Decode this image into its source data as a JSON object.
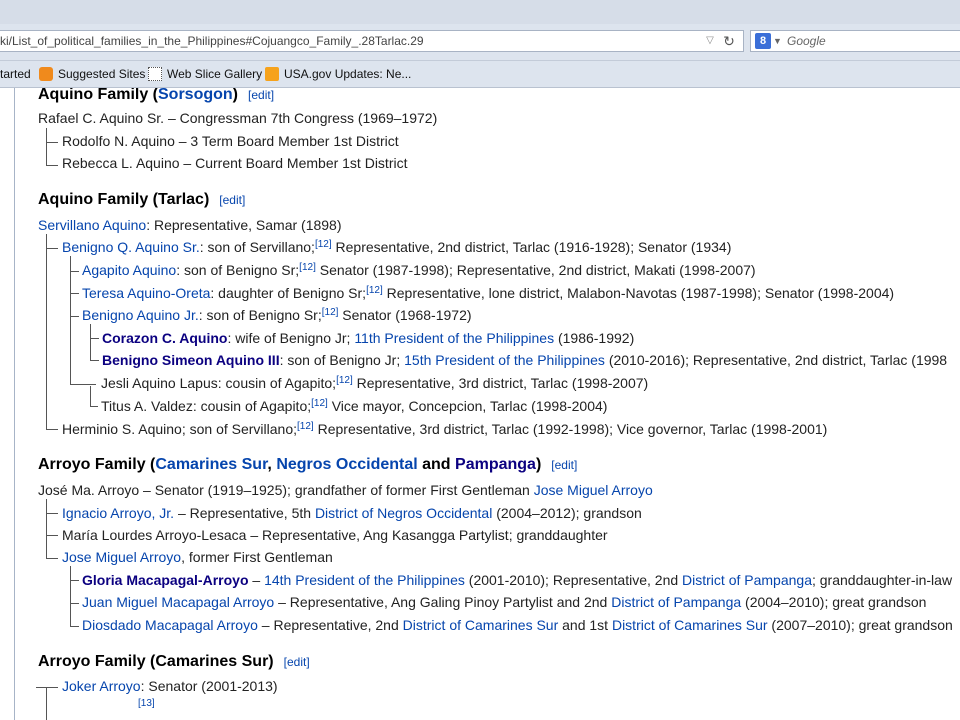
{
  "browser": {
    "url": "ki/List_of_political_families_in_the_Philippines#Cojuangco_Family_.28Tarlac.29",
    "search_placeholder": "Google",
    "search_engine_letter": "8",
    "bookmarks": [
      {
        "label": "tarted",
        "icon": ""
      },
      {
        "label": "Suggested Sites",
        "icon": "suggested-sites-icon"
      },
      {
        "label": "Web Slice Gallery",
        "icon": "web-slice-icon"
      },
      {
        "label": "USA.gov Updates: Ne...",
        "icon": "rss-feed-icon"
      }
    ]
  },
  "article": {
    "edit_label": "edit",
    "s1": {
      "title_prefix": "Aquino Family (",
      "title_link": "Sorsogon",
      "title_suffix": ")",
      "l0": "Rafael C. Aquino Sr. – Congressman 7th Congress (1969–1972)",
      "l1": "Rodolfo N. Aquino – 3 Term Board Member 1st District",
      "l2": "Rebecca L. Aquino – Current Board Member 1st District"
    },
    "s2": {
      "title": "Aquino Family (Tarlac)",
      "r0": {
        "link": "Servillano Aquino",
        "text": ": Representative, Samar (1898)"
      },
      "r1": {
        "link": "Benigno Q. Aquino Sr.",
        "text": ": son of Servillano;",
        "ref": "[12]",
        "text2": " Representative, 2nd district, Tarlac (1916-1928); Senator (1934)"
      },
      "r2": {
        "link": "Agapito Aquino",
        "text": ": son of Benigno Sr;",
        "ref": "[12]",
        "text2": " Senator (1987-1998); Representative, 2nd district, Makati (1998-2007)"
      },
      "r3": {
        "link": "Teresa Aquino-Oreta",
        "text": ": daughter of Benigno Sr;",
        "ref": "[12]",
        "text2": " Representative, lone district, Malabon-Navotas (1987-1998); Senator (1998-2004)"
      },
      "r4": {
        "link": "Benigno Aquino Jr.",
        "text": ": son of Benigno Sr;",
        "ref": "[12]",
        "text2": " Senator (1968-1972)"
      },
      "r5": {
        "link": "Corazon C. Aquino",
        "text": ": wife of Benigno Jr; ",
        "link2": "11th President of the Philippines",
        "text2": " (1986-1992)"
      },
      "r6": {
        "link": "Benigno Simeon Aquino III",
        "text": ": son of Benigno Jr; ",
        "link2": "15th President of the Philippines",
        "text2": " (2010-2016); Representative, 2nd district, Tarlac (1998"
      },
      "r7": {
        "text": "Jesli Aquino Lapus: cousin of Agapito;",
        "ref": "[12]",
        "text2": " Representative, 3rd district, Tarlac (1998-2007)"
      },
      "r8": {
        "text": "Titus A. Valdez: cousin of Agapito;",
        "ref": "[12]",
        "text2": " Vice mayor, Concepcion, Tarlac (1998-2004)"
      },
      "r9": {
        "text": "Herminio S. Aquino; son of Servillano;",
        "ref": "[12]",
        "text2": " Representative, 3rd district, Tarlac (1992-1998); Vice governor, Tarlac (1998-2001)"
      }
    },
    "s3": {
      "title_prefix": "Arroyo Family (",
      "link1": "Camarines Sur",
      "sep1": ", ",
      "link2": "Negros Occidental",
      "sep2": " and ",
      "link3": "Pampanga",
      "title_suffix": ")",
      "r0": {
        "text": "José Ma. Arroyo – Senator (1919–1925); grandfather of former First Gentleman ",
        "link": "Jose Miguel Arroyo"
      },
      "r1": {
        "link": "Ignacio Arroyo, Jr.",
        "text": " – Representative, 5th ",
        "link2": "District of Negros Occidental",
        "text2": " (2004–2012); grandson"
      },
      "r2": {
        "text": "María Lourdes Arroyo-Lesaca – Representative, Ang Kasangga Partylist; granddaughter"
      },
      "r3": {
        "link": "Jose Miguel Arroyo",
        "text": ", former First Gentleman"
      },
      "r4": {
        "link": "Gloria Macapagal-Arroyo",
        "text": " – ",
        "link2": "14th President of the Philippines",
        "text2": " (2001-2010); Representative, 2nd ",
        "link3": "District of Pampanga",
        "text3": "; granddaughter-in-law"
      },
      "r5": {
        "link": "Juan Miguel Macapagal Arroyo",
        "text": " – Representative, Ang Galing Pinoy Partylist and 2nd ",
        "link2": "District of Pampanga",
        "text2": " (2004–2010); great grandson"
      },
      "r6": {
        "link": "Diosdado Macapagal Arroyo",
        "text": " – Representative, 2nd ",
        "link2": "District of Camarines Sur",
        "text2": " and 1st ",
        "link3": "District of Camarines Sur",
        "text3": " (2007–2010); great grandson"
      }
    },
    "s4": {
      "title": "Arroyo Family (Camarines Sur)",
      "r0": {
        "link": "Joker Arroyo",
        "text": ": Senator (2001-2013)"
      },
      "r1": {
        "ref": "[13]"
      }
    }
  }
}
